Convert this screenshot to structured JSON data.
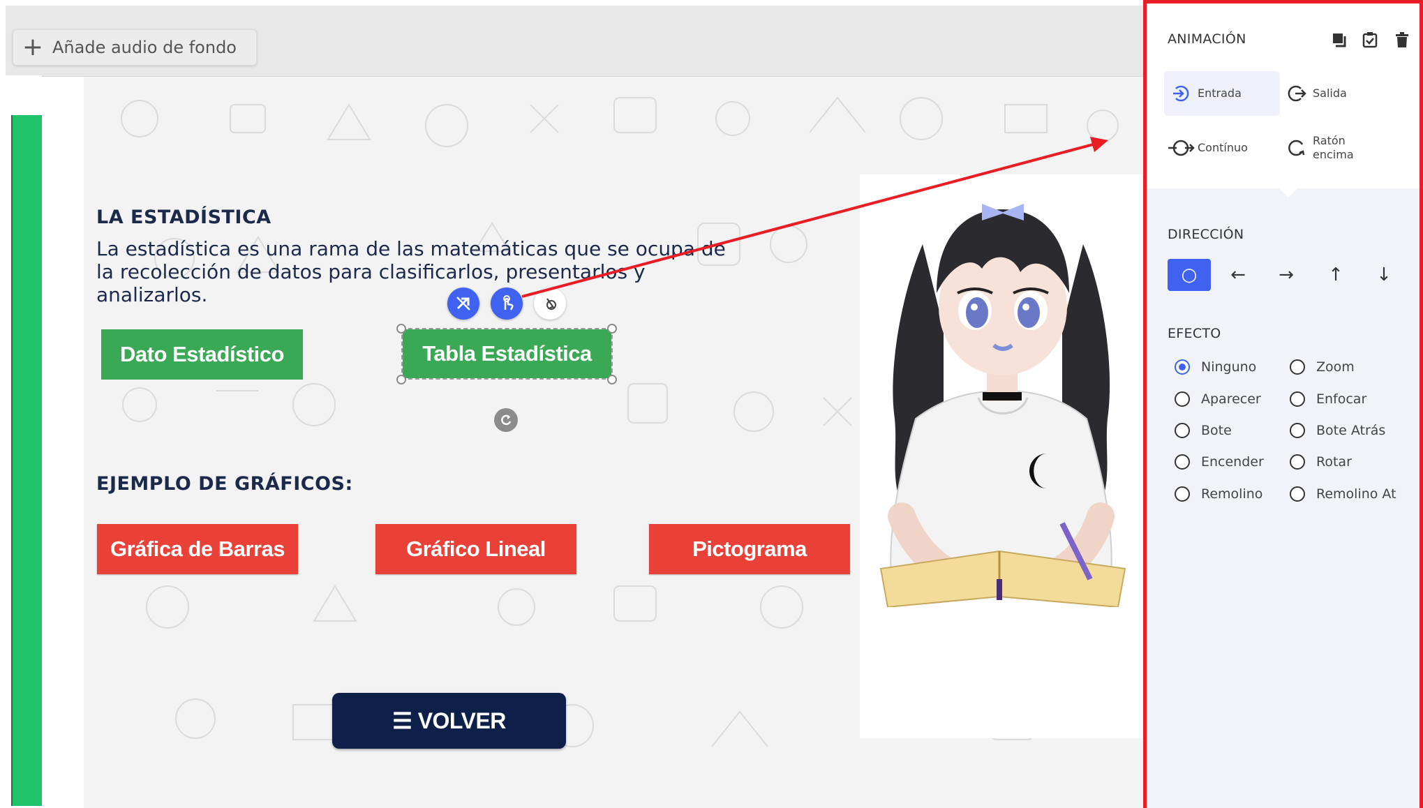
{
  "topbar": {
    "audio_label": "Añade audio de fondo",
    "audio_icon": "plus-icon"
  },
  "slide": {
    "heading": "LA ESTADÍSTICA",
    "body": "La estadística es una rama de las matemáticas que se ocupa de la recolección de datos para clasificarlos, presentarlos y analizarlos.",
    "buttons_top": [
      "Dato Estadístico",
      "Tabla Estadística"
    ],
    "examples_heading": "EJEMPLO DE GRÁFICOS:",
    "buttons_examples": [
      "Gráfica de Barras",
      "Gráfico Lineal",
      "Pictograma"
    ],
    "back_button": "☰ VOLVER",
    "colors": {
      "green": "#3aa955",
      "red": "#e94037",
      "navy": "#0e1f4a",
      "text": "#1b2a4a"
    }
  },
  "selection_tools": {
    "icons": [
      "no-animation-icon",
      "tap-animation-icon",
      "hover-pointer-icon"
    ],
    "rotate_icon": "rotate-icon"
  },
  "panel": {
    "animation_title": "ANIMACIÓN",
    "header_icons": [
      "copy-icon",
      "clipboard-check-icon",
      "trash-icon"
    ],
    "animation_types": [
      {
        "label": "Entrada",
        "icon": "enter-icon",
        "active": true
      },
      {
        "label": "Salida",
        "icon": "exit-icon",
        "active": false
      },
      {
        "label": "Contínuo",
        "icon": "continuous-icon",
        "active": false
      },
      {
        "label_1": "Ratón",
        "label_2": "encima",
        "icon": "hover-loop-icon",
        "active": false
      }
    ],
    "direction_title": "DIRECCIÓN",
    "directions": [
      {
        "glyph": "○",
        "name": "none",
        "active": true
      },
      {
        "glyph": "←",
        "name": "left",
        "active": false
      },
      {
        "glyph": "→",
        "name": "right",
        "active": false
      },
      {
        "glyph": "↑",
        "name": "up",
        "active": false
      },
      {
        "glyph": "↓",
        "name": "down",
        "active": false
      }
    ],
    "effect_title": "EFECTO",
    "effects_left": [
      "Ninguno",
      "Aparecer",
      "Bote",
      "Encender",
      "Remolino"
    ],
    "effects_right": [
      "Zoom",
      "Enfocar",
      "Bote Atrás",
      "Rotar",
      "Remolino At"
    ],
    "selected_effect": "Ninguno",
    "accent": "#3f63f0",
    "border_color": "#ea1c24"
  }
}
